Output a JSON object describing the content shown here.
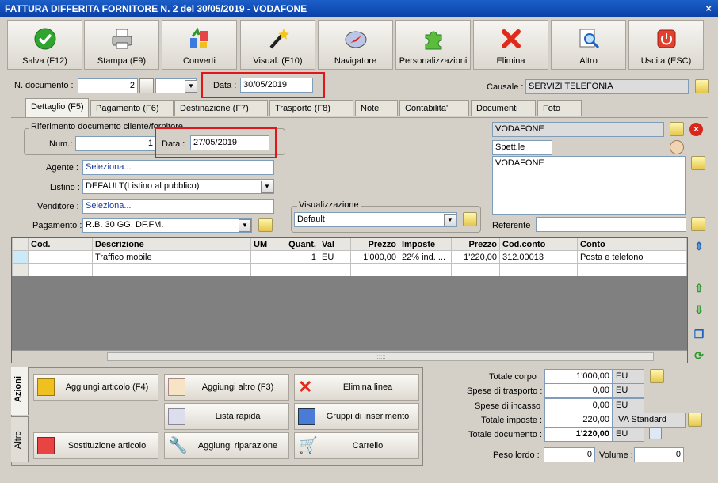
{
  "window": {
    "title": "FATTURA DIFFERITA FORNITORE N. 2 del 30/05/2019 - VODAFONE",
    "close": "×"
  },
  "toolbar": [
    {
      "label": "Salva (F12)",
      "icon": "check-icon"
    },
    {
      "label": "Stampa (F9)",
      "icon": "printer-icon"
    },
    {
      "label": "Converti",
      "icon": "convert-icon"
    },
    {
      "label": "Visual. (F10)",
      "icon": "wand-icon"
    },
    {
      "label": "Navigatore",
      "icon": "compass-icon"
    },
    {
      "label": "Personalizzazioni",
      "icon": "puzzle-icon"
    },
    {
      "label": "Elimina",
      "icon": "delete-x-icon"
    },
    {
      "label": "Altro",
      "icon": "magnifier-icon"
    },
    {
      "label": "Uscita (ESC)",
      "icon": "power-icon"
    }
  ],
  "header": {
    "ndoc_label": "N. documento :",
    "ndoc_value": "2",
    "data_label": "Data :",
    "data_value": "30/05/2019",
    "causale_label": "Causale :",
    "causale_value": "SERVIZI TELEFONIA"
  },
  "tabs": [
    "Dettaglio (F5)",
    "Pagamento (F6)",
    "Destinazione (F7)",
    "Trasporto (F8)",
    "Note",
    "Contabilita'",
    "Documenti",
    "Foto"
  ],
  "riferimento": {
    "legend": "Riferimento documento cliente/fornitore",
    "num_label": "Num.:",
    "num_value": "1",
    "data_label": "Data :",
    "data_value": "27/05/2019"
  },
  "form": {
    "agente_label": "Agente :",
    "agente_value": "Seleziona...",
    "listino_label": "Listino :",
    "listino_value": "DEFAULT(Listino al pubblico)",
    "venditore_label": "Venditore :",
    "venditore_value": "Seleziona...",
    "pagamento_label": "Pagamento :",
    "pagamento_value": "R.B. 30 GG. DF.FM.",
    "visualizzazione_legend": "Visualizzazione",
    "visualizzazione_value": "Default"
  },
  "supplier": {
    "name": "VODAFONE",
    "greeting": "Spett.le",
    "address": "VODAFONE",
    "referente_label": "Referente"
  },
  "grid": {
    "columns": [
      "Cod.",
      "Descrizione",
      "UM",
      "Quant.",
      "Val",
      "Prezzo",
      "Imposte",
      "Prezzo",
      "Cod.conto",
      "Conto"
    ],
    "rows": [
      [
        "",
        "Traffico mobile",
        "",
        "1",
        "EU",
        "1'000,00",
        "22% ind. ...",
        "1'220,00",
        "312.00013",
        "Posta e telefono"
      ]
    ],
    "grip": "::::::"
  },
  "side_tabs": [
    "Azioni",
    "Altro"
  ],
  "actions": [
    {
      "label": "Aggiungi articolo (F4)",
      "icon": "add-article-icon"
    },
    {
      "label": "Aggiungi altro (F3)",
      "icon": "add-other-icon"
    },
    {
      "label": "Elimina linea",
      "icon": "delete-line-icon"
    },
    {
      "label": "Lista rapida",
      "icon": "quick-list-icon"
    },
    {
      "label": "Gruppi di inserimento",
      "icon": "groups-icon"
    },
    {
      "label": "Sostituzione articolo",
      "icon": "replace-icon"
    },
    {
      "label": "Aggiungi riparazione",
      "icon": "wrench-icon"
    },
    {
      "label": "Carrello",
      "icon": "cart-icon"
    }
  ],
  "totals": {
    "corpo_label": "Totale corpo :",
    "corpo_value": "1'000,00",
    "corpo_cur": "EU",
    "trasporto_label": "Spese di trasporto :",
    "trasporto_value": "0,00",
    "trasporto_cur": "EU",
    "incasso_label": "Spese di incasso :",
    "incasso_value": "0,00",
    "incasso_cur": "EU",
    "imposte_label": "Totale imposte :",
    "imposte_value": "220,00",
    "imposte_note": "IVA Standard",
    "documento_label": "Totale documento :",
    "documento_value": "1'220,00",
    "documento_cur": "EU",
    "peso_label": "Peso lordo :",
    "peso_value": "0",
    "volume_label": "Volume :",
    "volume_value": "0"
  }
}
